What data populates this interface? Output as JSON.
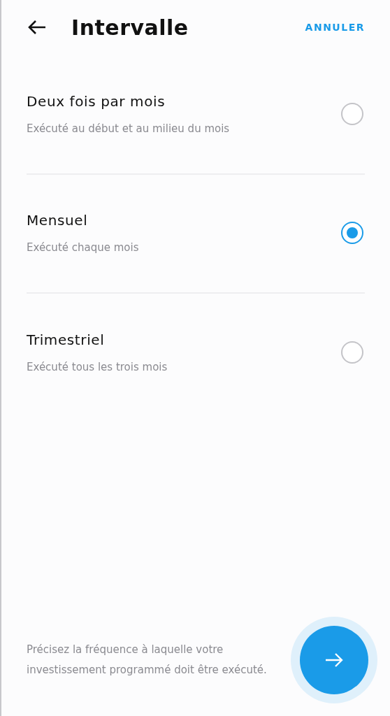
{
  "header": {
    "title": "Intervalle",
    "cancel": "ANNULER"
  },
  "options": [
    {
      "title": "Deux fois par mois",
      "description": "Exécuté au début et au milieu du mois",
      "selected": false
    },
    {
      "title": "Mensuel",
      "description": "Exécuté chaque mois",
      "selected": true
    },
    {
      "title": "Trimestriel",
      "description": "Exécuté tous les trois mois",
      "selected": false
    }
  ],
  "footer": {
    "hint": "Précisez la fréquence à laquelle votre investissement programmé doit être exécuté."
  }
}
